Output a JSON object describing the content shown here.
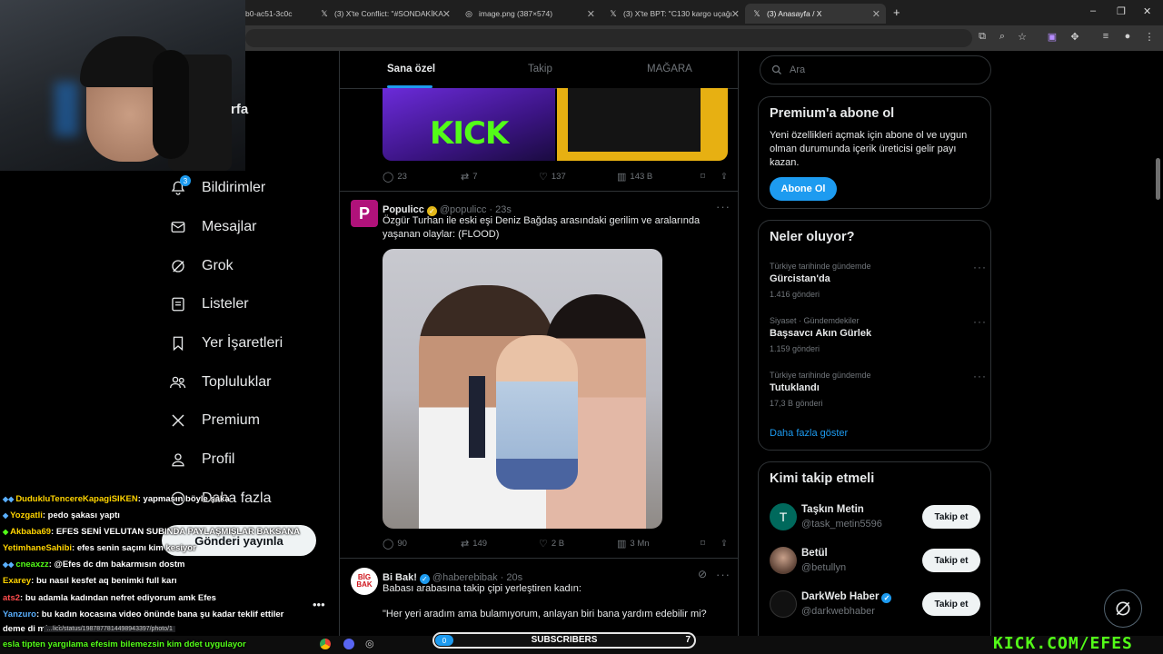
{
  "browser": {
    "tabs": [
      {
        "title": "b0-ac51-3c0c"
      },
      {
        "title": "(3) X'te Conflict: \"#SONDAKİKA"
      },
      {
        "title": "image.png (387×574)"
      },
      {
        "title": "(3) X'te BPT: \"C130 kargo uçağı"
      },
      {
        "title": "(3) Anasayfa / X"
      }
    ],
    "new_tab": "+",
    "window_controls": [
      "–",
      "❐",
      "✕"
    ]
  },
  "nav": {
    "partial_home": "rfa",
    "items": [
      {
        "label": "Bildirimler",
        "icon": "bell-icon",
        "badge": "3"
      },
      {
        "label": "Mesajlar",
        "icon": "mail-icon"
      },
      {
        "label": "Grok",
        "icon": "grok-icon"
      },
      {
        "label": "Listeler",
        "icon": "list-icon"
      },
      {
        "label": "Yer İşaretleri",
        "icon": "bookmark-icon"
      },
      {
        "label": "Topluluklar",
        "icon": "communities-icon"
      },
      {
        "label": "Premium",
        "icon": "x-logo-icon"
      },
      {
        "label": "Profil",
        "icon": "profile-icon"
      },
      {
        "label": "Daha fazla",
        "icon": "more-circle-icon"
      }
    ],
    "post_button": "Gönderi yayınla"
  },
  "feed": {
    "tabs": [
      "Sana özel",
      "Takip",
      "MAĞARA"
    ],
    "prev_tweet_stats": {
      "replies": "23",
      "retweets": "7",
      "likes": "137",
      "views": "143 B"
    },
    "tweet1": {
      "name": "Populicc",
      "handle": "@populicc",
      "time": "23s",
      "text_line1": "Özgür Turhan ile eski eşi Deniz Bağdaş arasındaki gerilim ve aralarında",
      "text_line2": "yaşanan olaylar: (FLOOD)",
      "stats": {
        "replies": "90",
        "retweets": "149",
        "likes": "2 B",
        "views": "3 Mn"
      }
    },
    "tweet2": {
      "name": "Bi Bak!",
      "handle": "@haberebibak",
      "time": "20s",
      "avatar_text": "BİG BAK",
      "text_line1": "Babası arabasına takip çipi yerleştiren kadın:",
      "text_line2": "\"Her yeri aradım ama bulamıyorum, anlayan biri bana yardım edebilir mi?"
    }
  },
  "right": {
    "search_placeholder": "Ara",
    "premium": {
      "title": "Premium'a abone ol",
      "line1": "Yeni özellikleri açmak için abone ol ve uygun",
      "line2": "olman durumunda içerik üreticisi gelir payı",
      "line3": "kazan.",
      "button": "Abone Ol"
    },
    "trends": {
      "title": "Neler oluyor?",
      "items": [
        {
          "category": "Türkiye tarihinde gündemde",
          "name": "Gürcistan'da",
          "count": "1.416 gönderi"
        },
        {
          "category": "Siyaset · Gündemdekiler",
          "name": "Başsavcı Akın Gürlek",
          "count": "1.159 gönderi"
        },
        {
          "category": "Türkiye tarihinde gündemde",
          "name": "Tutuklandı",
          "count": "17,3 B gönderi"
        }
      ],
      "show_more": "Daha fazla göster"
    },
    "who_to_follow": {
      "title": "Kimi takip etmeli",
      "users": [
        {
          "name": "Taşkın Metin",
          "handle": "@task_metin5596",
          "initial": "T",
          "button": "Takip et"
        },
        {
          "name": "Betül",
          "handle": "@betullyn",
          "button": "Takip et"
        },
        {
          "name": "DarkWeb Haber",
          "handle": "@darkwebhaber",
          "button": "Takip et"
        }
      ]
    }
  },
  "chat": [
    {
      "user": "DudukluTencereKapagiSIKEN",
      "color": "#ffd400",
      "msg": ": yapmasın böyle şaka"
    },
    {
      "user": "Yozgatli",
      "color": "#ffd400",
      "msg": ": pedo şakası yaptı"
    },
    {
      "user": "Akbaba69",
      "color": "#ffd400",
      "msg": ": EFES SENİ VELUTAN SUBINDA PAYLAŞMIŞLAR BAKSANA"
    },
    {
      "user": "YetimhaneSahibi",
      "color": "#ffd400",
      "msg": ": efes senin saçını kim kesiyor"
    },
    {
      "user": "cneaxzz",
      "color": "#53fc18",
      "msg": ": @Efes dc dm bakarmısın dostm"
    },
    {
      "user": "Exarey",
      "color": "#ffd400",
      "msg": ": bu nasıl kesfet aq benimki full karı"
    },
    {
      "user": "ats2",
      "color": "#ff4d4d",
      "msg": ": bu adamla kadından nefret ediyorum amk Efes"
    },
    {
      "user": "Yanzuro",
      "color": "#5ab0ff",
      "msg": ": bu kadın kocasına video önünde bana şu kadar teklif ettiler"
    },
    {
      "user": "",
      "color": "#ffffff",
      "msg": "deme di mi mk"
    },
    {
      "user": "",
      "color": "#53fc18",
      "msg": "esla tipten yargılama efesim bilemezsin kim ddet uygulayor"
    }
  ],
  "status_url": "…licc/status/1987877814498943397/photo/1",
  "stream": {
    "sub_count": "0",
    "sub_label": "SUBSCRIBERS",
    "sub_goal": "7",
    "logo": "KICK.COM/EFES"
  }
}
